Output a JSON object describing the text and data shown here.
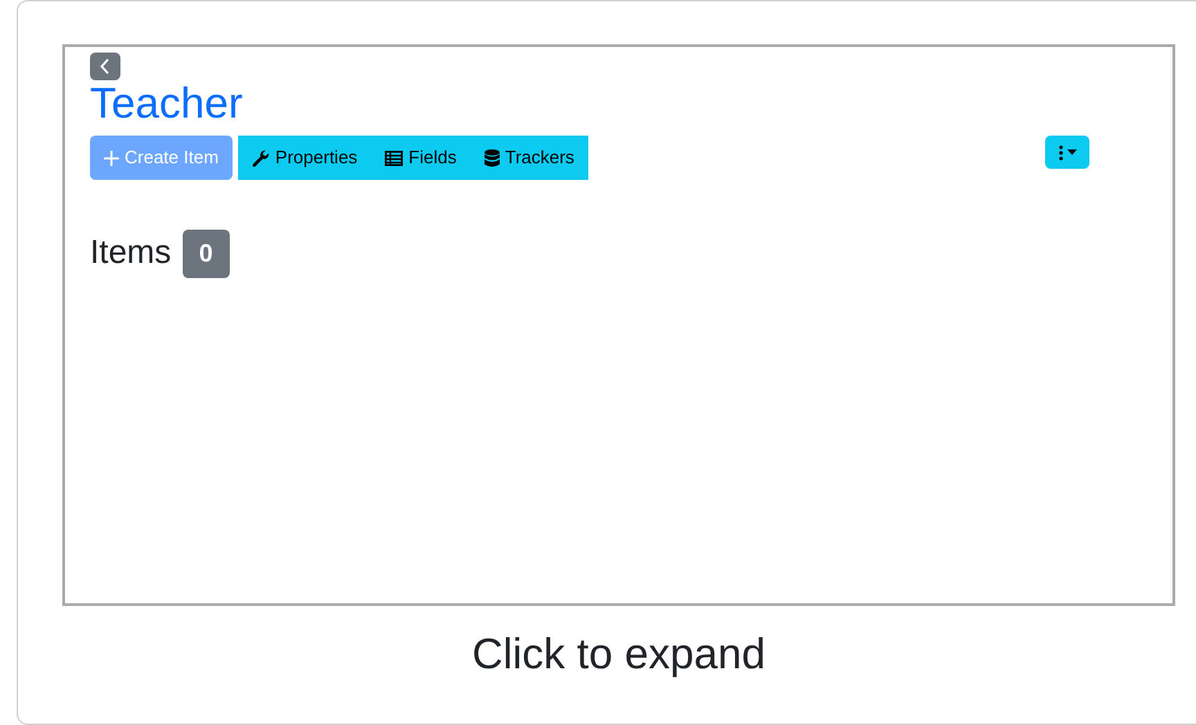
{
  "title": "Teacher",
  "toolbar": {
    "create_button": {
      "label": "Create Item",
      "disabled": true
    },
    "buttons": [
      {
        "kind": "wrench",
        "label": "Properties"
      },
      {
        "kind": "table",
        "label": "Fields"
      },
      {
        "kind": "database",
        "label": "Trackers"
      }
    ]
  },
  "items": {
    "heading": "Items",
    "count": "0"
  },
  "caption": "Click to expand"
}
